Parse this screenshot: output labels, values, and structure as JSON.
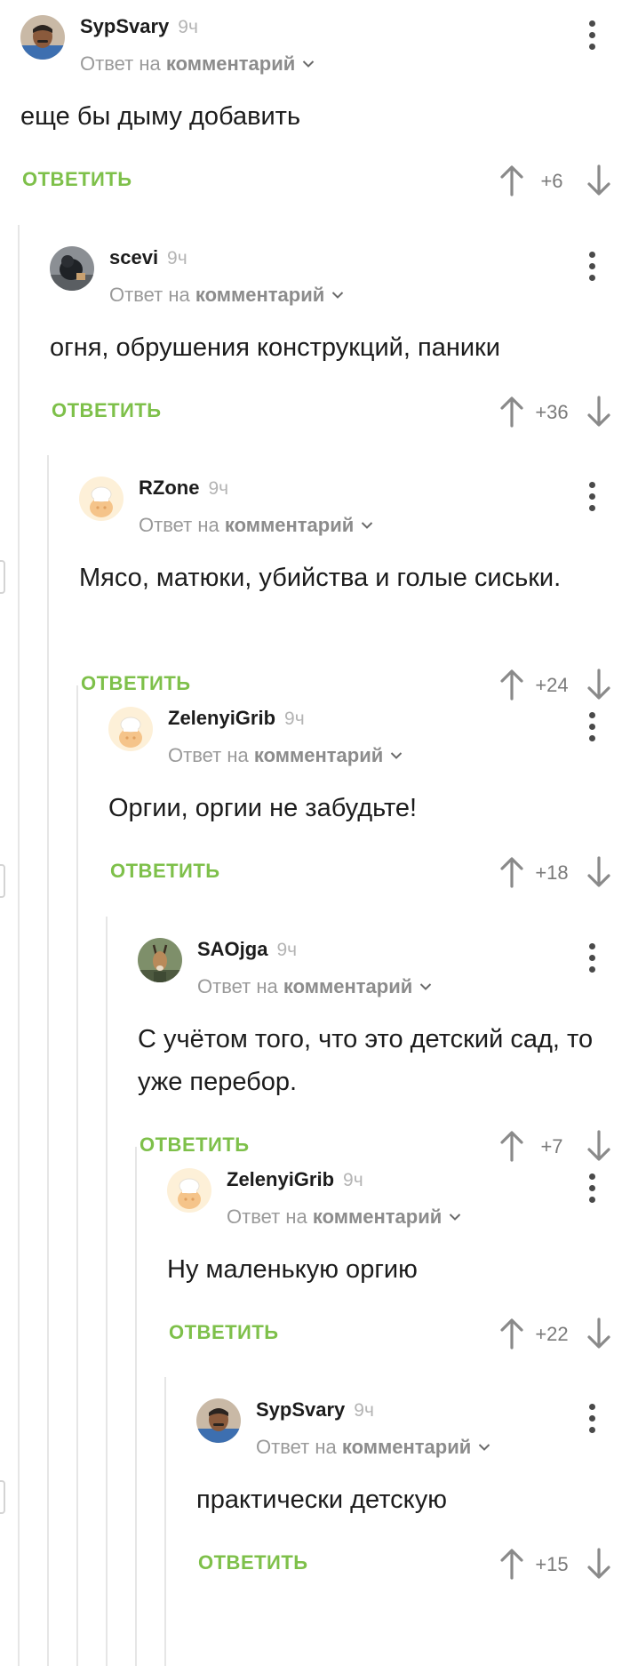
{
  "reply_to_prefix": "Ответ на",
  "reply_to_target": "комментарий",
  "reply_label": "ОТВЕТИТЬ",
  "colors": {
    "reply_green": "#7ec04a",
    "thread_line": "#e6e6e6",
    "muted_text": "#9a9a9a"
  },
  "icons": {
    "upvote": "arrow-up-icon",
    "downvote": "arrow-down-icon",
    "more": "more-vertical-icon",
    "expand": "chevron-down-icon"
  },
  "comments": [
    {
      "author": "SypSvary",
      "time": "9ч",
      "text": "еще бы дыму добавить",
      "score": "+6",
      "avatar": "man-photo-avatar"
    },
    {
      "author": "scevi",
      "time": "9ч",
      "text": "огня, обрушения конструкций, паники",
      "score": "+36",
      "avatar": "dark-figure-avatar"
    },
    {
      "author": "RZone",
      "time": "9ч",
      "text": "Мясо, матюки, убийства и голые сиськи.",
      "score": "+24",
      "avatar": "default-chef-avatar"
    },
    {
      "author": "ZelenyiGrib",
      "time": "9ч",
      "text": "Оргии, оргии не забудьте!",
      "score": "+18",
      "avatar": "default-chef-avatar"
    },
    {
      "author": "SAOjga",
      "time": "9ч",
      "text": "С учётом того, что это детский сад, то уже перебор.",
      "score": "+7",
      "avatar": "antelope-avatar"
    },
    {
      "author": "ZelenyiGrib",
      "time": "9ч",
      "text": "Ну маленькую оргию",
      "score": "+22",
      "avatar": "default-chef-avatar"
    },
    {
      "author": "SypSvary",
      "time": "9ч",
      "text": "практически детскую",
      "score": "+15",
      "avatar": "man-photo-avatar"
    }
  ]
}
